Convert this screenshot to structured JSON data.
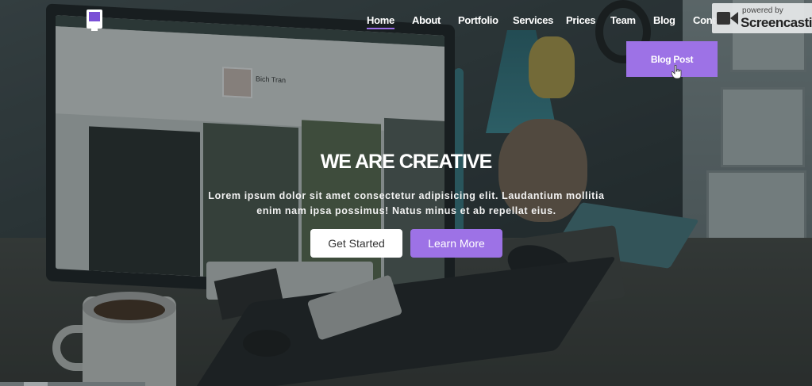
{
  "nav": {
    "items": [
      {
        "label": "Home",
        "active": true
      },
      {
        "label": "About"
      },
      {
        "label": "Portfolio"
      },
      {
        "label": "Services"
      },
      {
        "label": "Prices"
      },
      {
        "label": "Team"
      },
      {
        "label": "Blog"
      },
      {
        "label": "Conta"
      }
    ],
    "dropdown_item": "Blog Post"
  },
  "hero": {
    "title": "WE ARE CREATIVE",
    "subtitle_line1": "Lorem ipsum dolor sit amet consectetur adipisicing elit. Laudantium mollitia",
    "subtitle_line2": "enim nam ipsa possimus! Natus minus et ab repellat eius.",
    "primary_button": "Get Started",
    "secondary_button": "Learn More"
  },
  "background_screen": {
    "profile_name": "Bich Tran"
  },
  "watermark": {
    "small": "powered by",
    "big": "Screencastif"
  },
  "colors": {
    "accent": "#9d72e6",
    "text": "#ffffff",
    "overlay": "#141c1e"
  },
  "icons": {
    "logo": "monitor-logo-icon",
    "cursor": "hand-pointer-icon",
    "watermark": "screencastify-icon"
  }
}
